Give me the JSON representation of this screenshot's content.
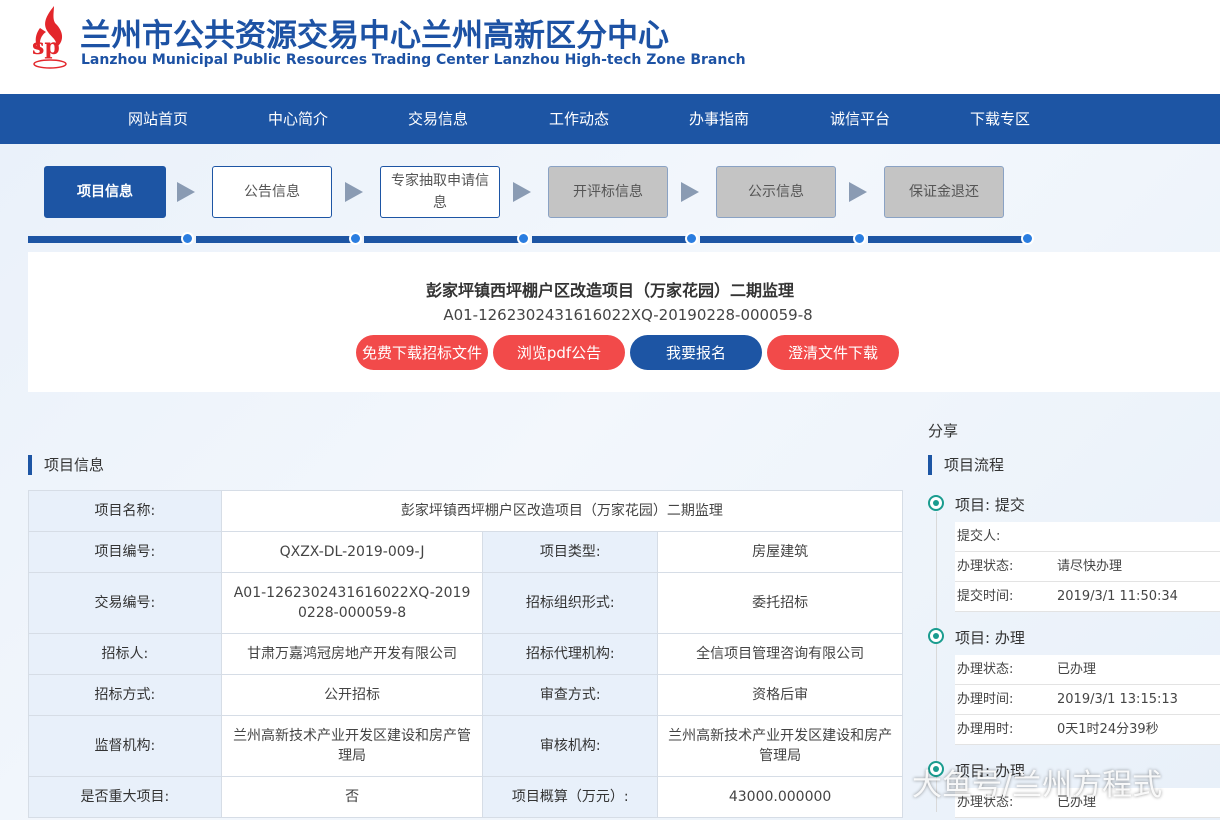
{
  "header": {
    "title_cn": "兰州市公共资源交易中心兰州高新区分中心",
    "title_en": "Lanzhou Municipal Public Resources Trading Center Lanzhou High-tech Zone Branch"
  },
  "nav": [
    "网站首页",
    "中心简介",
    "交易信息",
    "工作动态",
    "办事指南",
    "诚信平台",
    "下载专区"
  ],
  "steps": [
    "项目信息",
    "公告信息",
    "专家抽取申请信息",
    "开评标信息",
    "公示信息",
    "保证金退还"
  ],
  "project": {
    "title": "彭家坪镇西坪棚户区改造项目（万家花园）二期监理",
    "code": "A01-1262302431616022XQ-20190228-000059-8"
  },
  "buttons": {
    "download": "免费下载招标文件",
    "pdf": "浏览pdf公告",
    "signup": "我要报名",
    "clarify": "澄清文件下载"
  },
  "share": "分享",
  "section_info": "项目信息",
  "section_flow": "项目流程",
  "table": {
    "name_lbl": "项目名称:",
    "name_val": "彭家坪镇西坪棚户区改造项目（万家花园）二期监理",
    "no_lbl": "项目编号:",
    "no_val": "QXZX-DL-2019-009-J",
    "type_lbl": "项目类型:",
    "type_val": "房屋建筑",
    "tx_lbl": "交易编号:",
    "tx_val": "A01-1262302431616022XQ-20190228-000059-8",
    "org_lbl": "招标组织形式:",
    "org_val": "委托招标",
    "tenderer_lbl": "招标人:",
    "tenderer_val": "甘肃万嘉鸿冠房地产开发有限公司",
    "agent_lbl": "招标代理机构:",
    "agent_val": "全信项目管理咨询有限公司",
    "method_lbl": "招标方式:",
    "method_val": "公开招标",
    "review_lbl": "审查方式:",
    "review_val": "资格后审",
    "super_lbl": "监督机构:",
    "super_val": "兰州高新技术产业开发区建设和房产管理局",
    "audit_lbl": "审核机构:",
    "audit_val": "兰州高新技术产业开发区建设和房产管理局",
    "major_lbl": "是否重大项目:",
    "major_val": "否",
    "budget_lbl": "项目概算（万元）:",
    "budget_val": "43000.000000"
  },
  "flow": {
    "s1": "项目: 提交",
    "s1_rows": [
      [
        "提交人:",
        ""
      ],
      [
        "办理状态:",
        "请尽快办理"
      ],
      [
        "提交时间:",
        "2019/3/1 11:50:34"
      ]
    ],
    "s2": "项目: 办理",
    "s2_rows": [
      [
        "办理状态:",
        "已办理"
      ],
      [
        "办理时间:",
        "2019/3/1 13:15:13"
      ],
      [
        "办理用时:",
        "0天1时24分39秒"
      ]
    ],
    "s3": "项目: 办理",
    "s3_rows": [
      [
        "办理状态:",
        "已办理"
      ]
    ]
  },
  "watermark": "大鱼号/兰州方程式"
}
